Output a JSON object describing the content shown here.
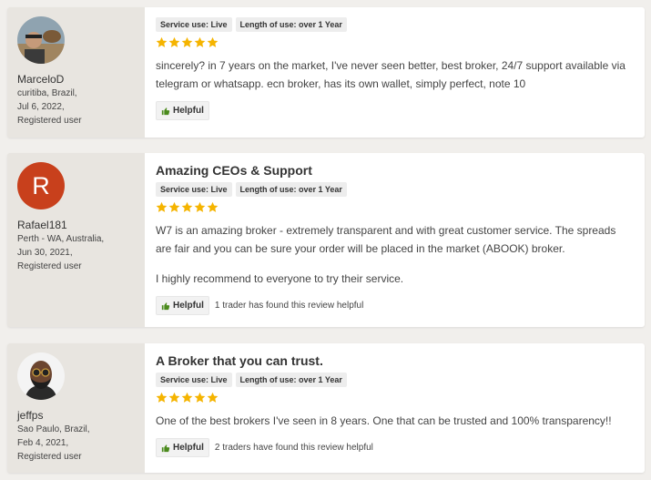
{
  "colors": {
    "star": "#f5b400",
    "letter_avatar": "#c8401c",
    "thumb": "#4a8a1c"
  },
  "reviews": [
    {
      "user": {
        "name": "MarceloD",
        "location": "curitiba, Brazil,",
        "date": "Jul 6, 2022,",
        "status": "Registered user"
      },
      "tags": [
        "Service use: Live",
        "Length of use: over 1 Year"
      ],
      "rating": 5,
      "body": [
        "sincerely? in 7 years on the market, I've never seen better, best broker, 24/7 support available via telegram or whatsapp. ecn broker, has its own wallet, simply perfect, note 10"
      ],
      "helpful_label": "Helpful"
    },
    {
      "title": "Amazing CEOs & Support",
      "user": {
        "initial": "R",
        "name": "Rafael181",
        "location": "Perth - WA, Australia,",
        "date": "Jun 30, 2021,",
        "status": "Registered user"
      },
      "tags": [
        "Service use: Live",
        "Length of use: over 1 Year"
      ],
      "rating": 5,
      "body": [
        "W7 is an amazing broker - extremely transparent and with great customer service. The spreads are fair and you can be sure your order will be placed in the market (ABOOK) broker.",
        "I highly recommend to everyone to try their service."
      ],
      "helpful_label": "Helpful",
      "helpful_note": "1 trader has found this review helpful"
    },
    {
      "title": "A Broker that you can trust.",
      "user": {
        "name": "jeffps",
        "location": "Sao Paulo, Brazil,",
        "date": "Feb 4, 2021,",
        "status": "Registered user"
      },
      "tags": [
        "Service use: Live",
        "Length of use: over 1 Year"
      ],
      "rating": 5,
      "body": [
        "One of the best brokers I've seen in 8 years. One that can be trusted and 100% transparency!!"
      ],
      "helpful_label": "Helpful",
      "helpful_note": "2 traders have found this review helpful"
    }
  ]
}
